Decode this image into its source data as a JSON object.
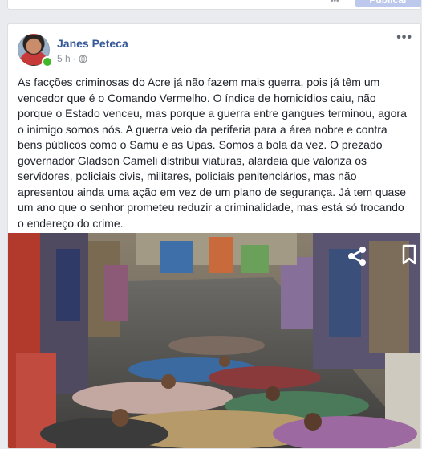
{
  "previous_card": {
    "more_glyph": "•••",
    "button_label": "Publicar"
  },
  "post": {
    "author": "Janes Peteca",
    "time": "5 h",
    "separator": "·",
    "privacy_icon": "globe-icon",
    "more_icon": "more-horizontal-icon",
    "text": "As facções criminosas do Acre já não fazem mais guerra, pois já têm um vencedor que é o Comando Vermelho. O índice de homicídios caiu, não porque o Estado venceu, mas porque a guerra entre gangues terminou, agora o inimigo somos nós. A guerra veio da periferia para a área nobre e contra bens públicos como o Samu e as Upas. Somos a bola da vez. O prezado governador Gladson Cameli distribui viaturas, alardeia que valoriza os servidores, policiais civis, militares, policiais penitenciários, mas não apresentou ainda uma ação em vez de um plano de segurança. Já tem quase um ano que o senhor prometeu reduzir a criminalidade, mas está só trocando o endereço do crime.",
    "photo": {
      "overlay_icons": [
        "share-icon",
        "bookmark-icon"
      ]
    }
  },
  "colors": {
    "page_background": "#e9ebee",
    "author_link": "#365899",
    "body_text": "#1d2129",
    "meta_text": "#90949c",
    "online_indicator": "#42b72a"
  }
}
